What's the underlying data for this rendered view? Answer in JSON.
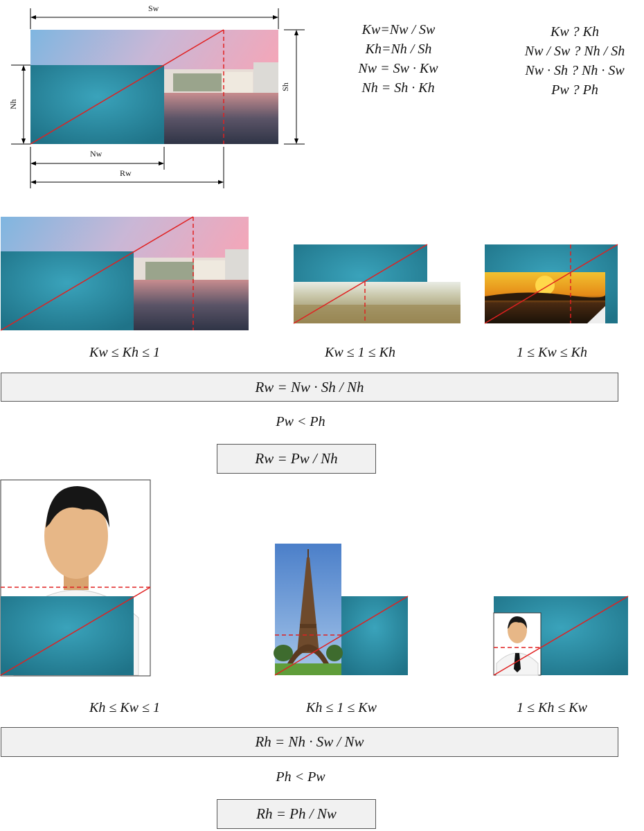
{
  "colors": {
    "teal": "#2f8ea6",
    "teal_dark": "#1d6f84",
    "red_line": "#e02020",
    "box_fill": "#f1f1f1"
  },
  "top_diagram": {
    "labels": {
      "sw": "Sw",
      "sh": "Sh",
      "nh": "Nh",
      "nw": "Nw",
      "rw": "Rw"
    }
  },
  "formulas_left": [
    "Kw=Nw / Sw",
    "Kh=Nh / Sh",
    "Nw = Sw · Kw",
    "Nh = Sh · Kh"
  ],
  "formulas_right": [
    "Kw  ? Kh",
    "Nw / Sw   ? Nh / Sh",
    "Nw   · Sh  ? Nh · Sw",
    "Pw  ? Ph"
  ],
  "row1": {
    "conditions": [
      "Kw ≤ Kh ≤ 1",
      "Kw ≤ 1 ≤ Kh",
      "1 ≤ Kw ≤ Kh"
    ],
    "wide_box": "Rw  = Nw · Sh / Nh",
    "comparison": "Pw < Ph",
    "small_box": "Rw  = Pw   / Nh"
  },
  "row2": {
    "conditions": [
      "Kh ≤ Kw ≤ 1",
      "Kh ≤ 1 ≤ Kw",
      "1 ≤ Kh ≤ Kw"
    ],
    "wide_box": "Rh = Nh · Sw / Nw",
    "comparison": "Ph < Pw",
    "small_box": "Rh = Ph  / Nw"
  }
}
